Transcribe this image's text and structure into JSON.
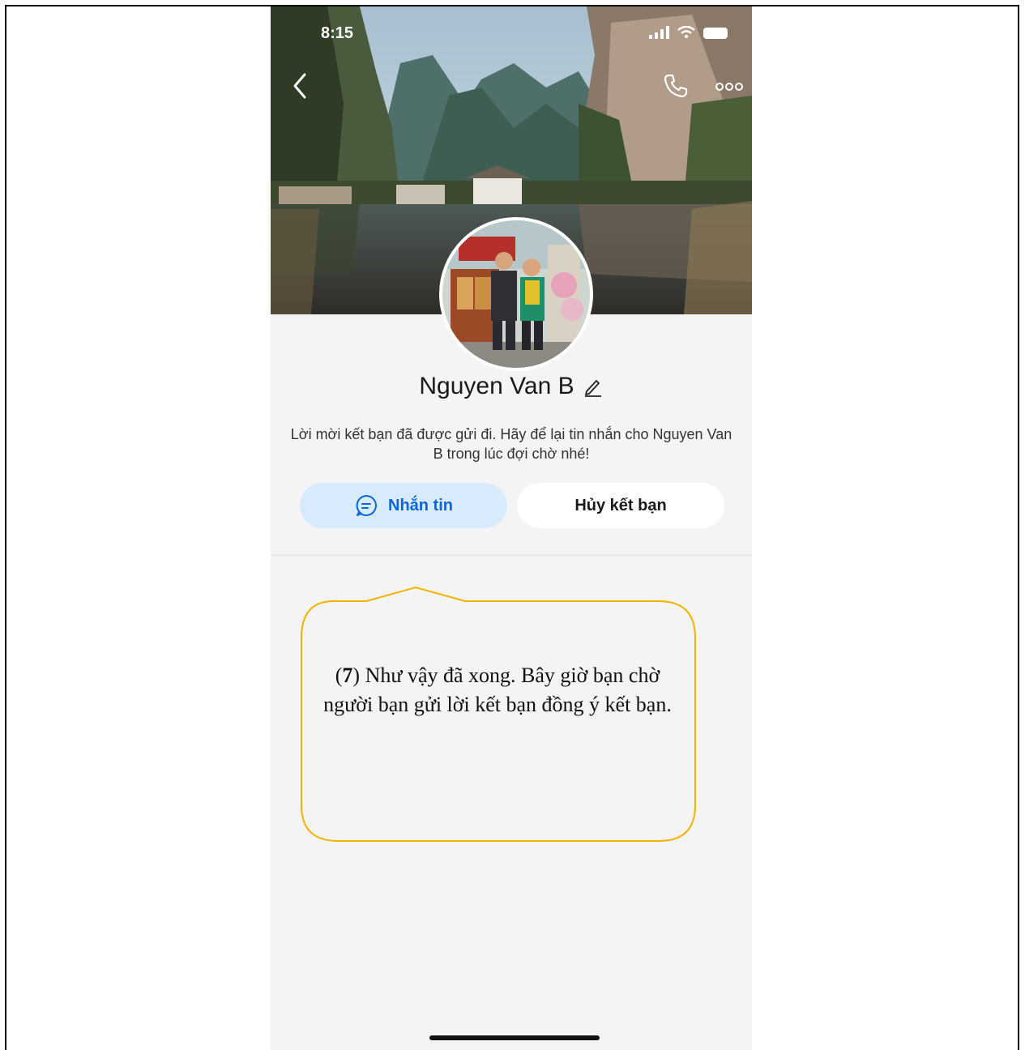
{
  "status_bar": {
    "time": "8:15"
  },
  "profile": {
    "name": "Nguyen Van B",
    "description": "Lời mời kết bạn đã được gửi đi. Hãy để lại tin nhắn cho Nguyen Van B trong lúc đợi chờ nhé!"
  },
  "actions": {
    "message_label": "Nhắn tin",
    "cancel_label": "Hủy kết bạn"
  },
  "callout": {
    "step_open": "(",
    "step_number": "7",
    "step_close": ")",
    "text": " Như vậy đã xong. Bây giờ bạn chờ người bạn gửi lời kết bạn đồng ý kết bạn."
  },
  "icons": [
    "back-icon",
    "phone-icon",
    "more-icon",
    "edit-icon",
    "chat-icon"
  ],
  "colors": {
    "accent": "#0a66d8",
    "message_button_bg": "#d8ebfc",
    "callout_border": "#f2b300"
  }
}
